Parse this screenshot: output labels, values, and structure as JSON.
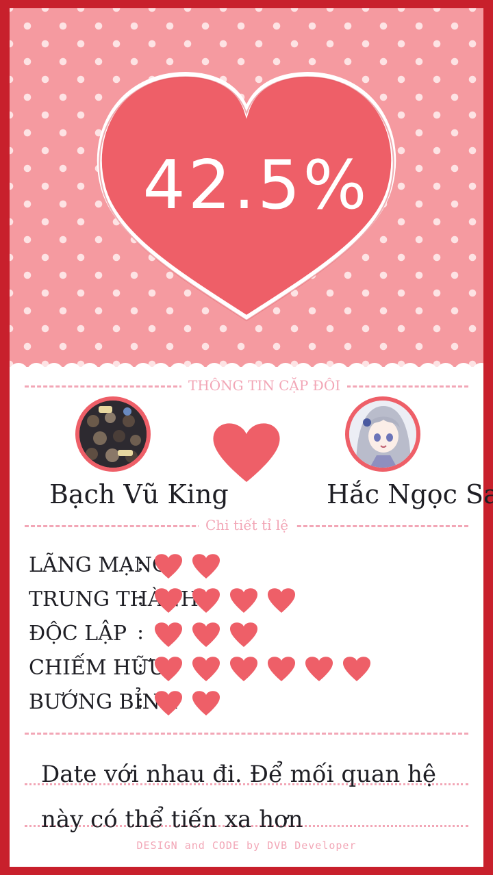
{
  "match": {
    "percent_label": "42.5%",
    "percent_value": 42.5
  },
  "sections": {
    "couple_info": "THÔNG TIN CẶP ĐÔI",
    "ratio_details": "Chi tiết tỉ lệ"
  },
  "person_left": {
    "name": "Bạch Vũ King",
    "avatar": "avatar-photo-crowd"
  },
  "person_right": {
    "name": "Hắc Ngọc Sa",
    "avatar": "avatar-photo-anime-girl"
  },
  "stats": [
    {
      "label": "LÃNG MẠNG",
      "hearts": 2
    },
    {
      "label": "TRUNG THÀNH",
      "hearts": 4
    },
    {
      "label": "ĐỘC LẬP",
      "hearts": 3
    },
    {
      "label": "CHIẾM HỮU",
      "hearts": 6
    },
    {
      "label": "BƯỚNG BỈNH",
      "hearts": 2
    }
  ],
  "stat_separator": ":",
  "message": "Date với nhau đi. Để mối quan hệ này có thể tiến xa hơn",
  "credit": "DESIGN and CODE by DVB Developer",
  "colors": {
    "frame": "#c8202c",
    "heart": "#ee5f68",
    "pink_bg": "#f59aa0",
    "accent": "#f2a6b6"
  }
}
